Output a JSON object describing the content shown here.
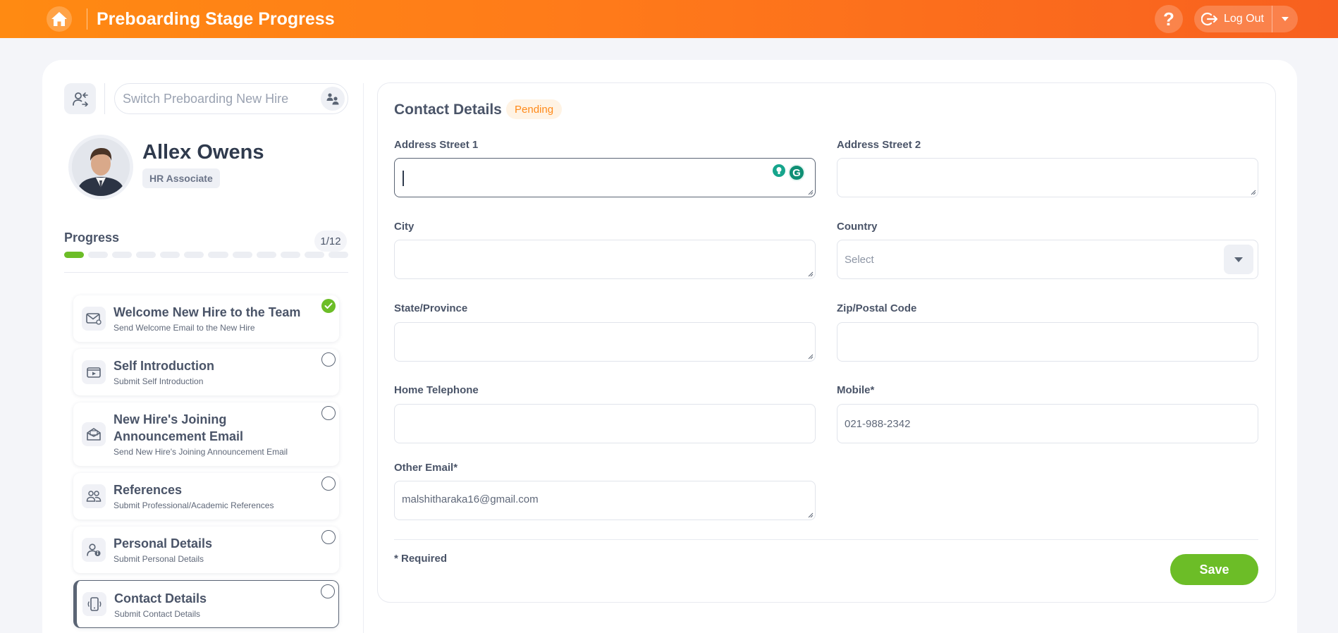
{
  "header": {
    "title": "Preboarding Stage Progress",
    "logout_label": "Log Out",
    "help_label": "?"
  },
  "sidebar": {
    "switch_placeholder": "Switch Preboarding New Hire",
    "user": {
      "name": "Allex Owens",
      "role": "HR Associate"
    },
    "progress": {
      "label": "Progress",
      "count": "1/12",
      "completed": 1,
      "total": 12
    },
    "stages": [
      {
        "title": "Welcome New Hire to the Team",
        "subtitle": "Send Welcome Email to the New Hire",
        "icon": "mail-at-icon",
        "status": "completed"
      },
      {
        "title": "Self Introduction",
        "subtitle": "Submit Self Introduction",
        "icon": "video-icon",
        "status": "open"
      },
      {
        "title": "New Hire's Joining Announcement Email",
        "subtitle": "Send New Hire's Joining Announcement Email",
        "icon": "mail-open-icon",
        "status": "open"
      },
      {
        "title": "References",
        "subtitle": "Submit Professional/Academic References",
        "icon": "users-icon",
        "status": "open"
      },
      {
        "title": "Personal Details",
        "subtitle": "Submit Personal Details",
        "icon": "user-info-icon",
        "status": "open"
      },
      {
        "title": "Contact Details",
        "subtitle": "Submit Contact Details",
        "icon": "mobile-icon",
        "status": "open"
      }
    ]
  },
  "form": {
    "title": "Contact Details",
    "status": "Pending",
    "fields": {
      "address1": {
        "label": "Address Street 1",
        "value": ""
      },
      "address2": {
        "label": "Address Street 2",
        "value": ""
      },
      "city": {
        "label": "City",
        "value": ""
      },
      "country": {
        "label": "Country",
        "value": "Select"
      },
      "state": {
        "label": "State/Province",
        "value": ""
      },
      "zip": {
        "label": "Zip/Postal Code",
        "value": ""
      },
      "home_phone": {
        "label": "Home Telephone",
        "value": ""
      },
      "mobile": {
        "label": "Mobile*",
        "value": "021-988-2342"
      },
      "other_email": {
        "label": "Other Email*",
        "value": "malshitharaka16@gmail.com"
      }
    },
    "required_note": "* Required",
    "save_label": "Save"
  },
  "colors": {
    "accent": "#ff7a1a",
    "success": "#6cbd27",
    "pending": "#ff8a1a"
  }
}
